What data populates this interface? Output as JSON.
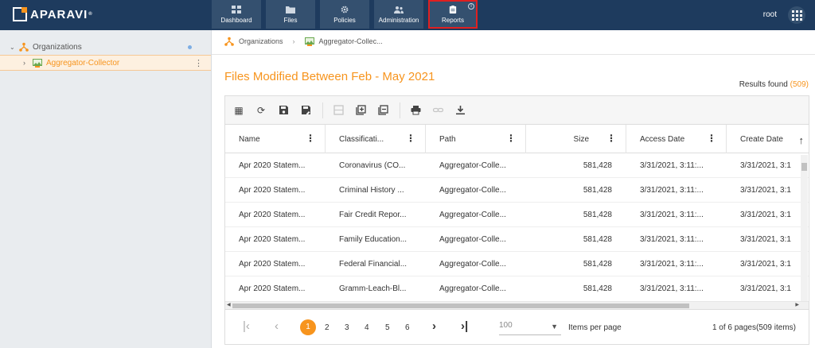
{
  "app": {
    "logo_text": "APARAVI",
    "logo_tm": "®"
  },
  "nav": [
    {
      "label": "Dashboard",
      "icon": "dashboard-icon"
    },
    {
      "label": "Files",
      "icon": "folder-icon"
    },
    {
      "label": "Policies",
      "icon": "gear-icon"
    },
    {
      "label": "Administration",
      "icon": "users-icon"
    },
    {
      "label": "Reports",
      "icon": "clipboard-icon",
      "active": true,
      "info": "i"
    }
  ],
  "user": {
    "name": "root"
  },
  "sidebar": {
    "root_label": "Organizations",
    "selected_label": "Aggregator-Collector"
  },
  "breadcrumb": {
    "first": "Organizations",
    "second": "Aggregator-Collec..."
  },
  "report": {
    "title": "Files Modified Between Feb - May 2021",
    "results_label": "Results found",
    "results_count": "(509)"
  },
  "table": {
    "columns": [
      "Name",
      "Classificati...",
      "Path",
      "Size",
      "Access Date",
      "Create Date"
    ],
    "rows": [
      [
        "Apr 2020 Statem...",
        "Coronavirus (CO...",
        "Aggregator-Colle...",
        "581,428",
        "3/31/2021, 3:11:...",
        "3/31/2021, 3:1"
      ],
      [
        "Apr 2020 Statem...",
        "Criminal History ...",
        "Aggregator-Colle...",
        "581,428",
        "3/31/2021, 3:11:...",
        "3/31/2021, 3:1"
      ],
      [
        "Apr 2020 Statem...",
        "Fair Credit Repor...",
        "Aggregator-Colle...",
        "581,428",
        "3/31/2021, 3:11:...",
        "3/31/2021, 3:1"
      ],
      [
        "Apr 2020 Statem...",
        "Family Education...",
        "Aggregator-Colle...",
        "581,428",
        "3/31/2021, 3:11:...",
        "3/31/2021, 3:1"
      ],
      [
        "Apr 2020 Statem...",
        "Federal Financial...",
        "Aggregator-Colle...",
        "581,428",
        "3/31/2021, 3:11:...",
        "3/31/2021, 3:1"
      ],
      [
        "Apr 2020 Statem...",
        "Gramm-Leach-Bl...",
        "Aggregator-Colle...",
        "581,428",
        "3/31/2021, 3:11:...",
        "3/31/2021, 3:1"
      ]
    ]
  },
  "pager": {
    "pages": [
      "1",
      "2",
      "3",
      "4",
      "5",
      "6"
    ],
    "current": "1",
    "items_per_page_value": "100",
    "items_per_page_label": "Items per page",
    "summary": "1 of 6 pages(509 items)"
  },
  "colors": {
    "accent": "#f7941d",
    "topbar": "#1e3b5e",
    "nav_button": "#34506f",
    "active_outline": "#e02020"
  }
}
